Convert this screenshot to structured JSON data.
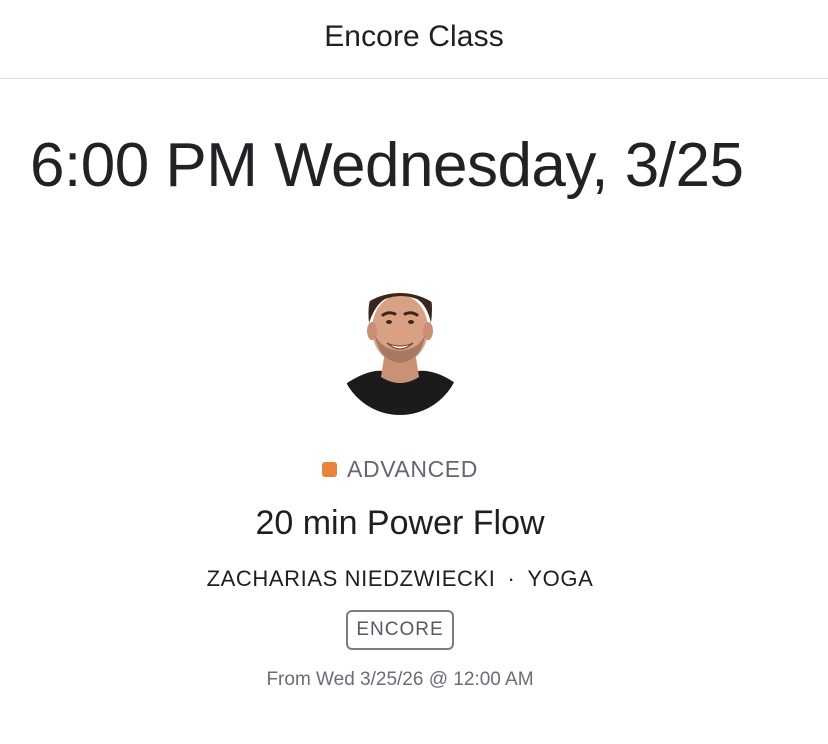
{
  "header": {
    "title": "Encore Class"
  },
  "schedule": {
    "datetime": "6:00 PM Wednesday, 3/25"
  },
  "instructor": {
    "avatar_icon": "instructor-avatar",
    "name": "ZACHARIAS NIEDZWIECKI"
  },
  "class": {
    "level": "ADVANCED",
    "level_color": "#e8853a",
    "title": "20 min Power Flow",
    "separator": "·",
    "category": "YOGA",
    "badge": "ENCORE",
    "availability": "From Wed 3/25/26 @ 12:00 AM"
  }
}
